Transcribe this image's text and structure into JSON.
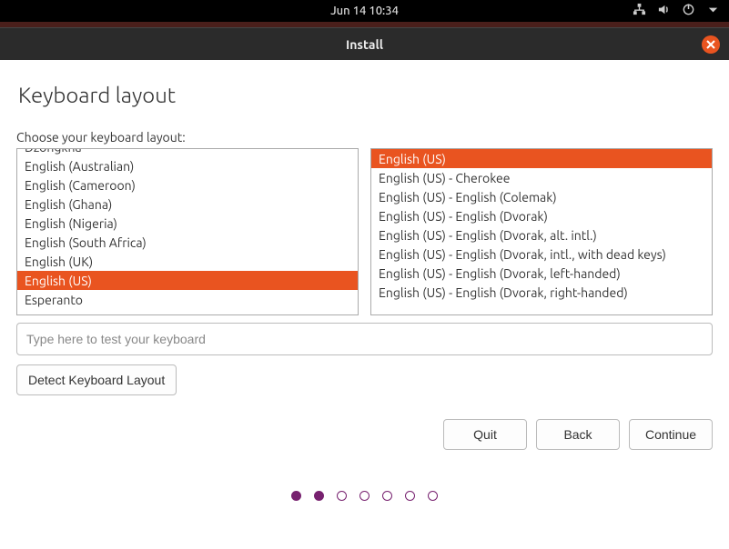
{
  "topbar": {
    "datetime": "Jun 14  10:34"
  },
  "titlebar": {
    "title": "Install"
  },
  "header": {
    "title": "Keyboard layout"
  },
  "content": {
    "choose_label": "Choose your keyboard layout:",
    "left_pane": [
      "Dzongkha",
      "English (Australian)",
      "English (Cameroon)",
      "English (Ghana)",
      "English (Nigeria)",
      "English (South Africa)",
      "English (UK)",
      "English (US)",
      "Esperanto"
    ],
    "left_selected_index": 7,
    "right_pane": [
      "English (US)",
      "English (US) - Cherokee",
      "English (US) - English (Colemak)",
      "English (US) - English (Dvorak)",
      "English (US) - English (Dvorak, alt. intl.)",
      "English (US) - English (Dvorak, intl., with dead keys)",
      "English (US) - English (Dvorak, left-handed)",
      "English (US) - English (Dvorak, right-handed)"
    ],
    "right_selected_index": 0,
    "test_placeholder": "Type here to test your keyboard",
    "detect_label": "Detect Keyboard Layout"
  },
  "buttons": {
    "quit": "Quit",
    "back": "Back",
    "continue": "Continue"
  },
  "progress": {
    "total": 7,
    "current": 2
  }
}
